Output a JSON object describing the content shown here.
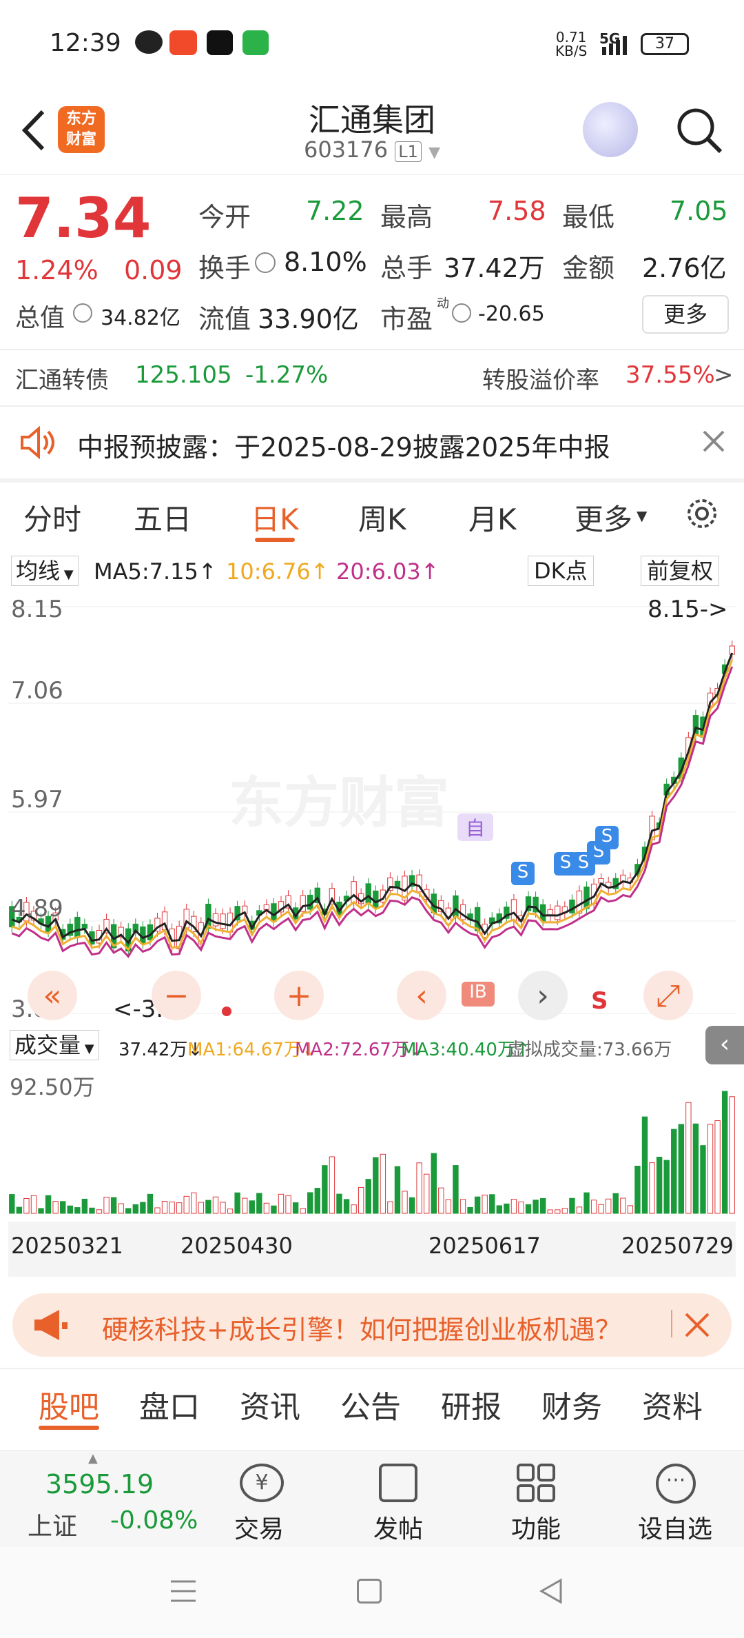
{
  "status_bar": {
    "time": "12:39",
    "net_speed": "0.71",
    "net_unit": "KB/S",
    "signal": "5G",
    "battery": "37"
  },
  "header": {
    "title": "汇通集团",
    "code": "603176",
    "level": "L1",
    "logo_text_1": "东方",
    "logo_text_2": "财富"
  },
  "quote": {
    "price": "7.34",
    "change_pct": "1.24%",
    "change": "0.09",
    "open_label": "今开",
    "open": "7.22",
    "high_label": "最高",
    "high": "7.58",
    "low_label": "最低",
    "low": "7.05",
    "turnover_label": "换手",
    "turnover": "8.10%",
    "volume_label": "总手",
    "volume": "37.42万",
    "amount_label": "金额",
    "amount": "2.76亿",
    "mktcap_label": "总值",
    "mktcap": "34.82亿",
    "float_label": "流值",
    "float": "33.90亿",
    "pe_label": "市盈",
    "pe_sup": "动",
    "pe": "-20.65",
    "more_button": "更多"
  },
  "bond": {
    "label": "汇通转债",
    "price": "125.105",
    "change": "-1.27%",
    "premium_label": "转股溢价率",
    "premium": "37.55%"
  },
  "notice": {
    "text": "中报预披露：于2025-08-29披露2025年中报"
  },
  "k_tabs": [
    "分时",
    "五日",
    "日K",
    "周K",
    "月K",
    "更多"
  ],
  "k_tab_active": "日K",
  "ma_bar": {
    "selector": "均线",
    "ma5": "MA5:7.15",
    "ma10": "10:6.76",
    "ma20": "20:6.03",
    "dk": "DK点",
    "adjust": "前复权"
  },
  "chart_data": {
    "type": "candlestick",
    "y_ticks": [
      "8.15",
      "7.06",
      "5.97",
      "4.89",
      "3.80"
    ],
    "max_label": "8.15->",
    "min_label": "<-3.80",
    "markers": {
      "self": "自",
      "sell": "S",
      "bs": "IB"
    },
    "x_ticks": [
      "20250321",
      "20250430",
      "20250617",
      "20250729"
    ],
    "watermark": "东方财富",
    "colors": {
      "up": "#e0363a",
      "down": "#1a9a3a",
      "ma5": "#222222",
      "ma10": "#f0b030",
      "ma20": "#c0308a"
    }
  },
  "volume_bar": {
    "selector": "成交量",
    "vol": "37.42万",
    "ma1": "MA1:64.67万",
    "ma2": "MA2:72.67万",
    "ma3": "MA3:40.40万",
    "virtual": "虚拟成交量:73.66万",
    "max": "92.50万"
  },
  "banner": {
    "text": "硬核科技+成长引擎！如何把握创业板机遇？"
  },
  "bottom_tabs": [
    "股吧",
    "盘口",
    "资讯",
    "公告",
    "研报",
    "财务",
    "资料"
  ],
  "bottom_tab_active": "股吧",
  "nav": {
    "index_value": "3595.19",
    "index_name": "上证",
    "index_change": "-0.08%",
    "trade": "交易",
    "post": "发帖",
    "function": "功能",
    "watchlist": "设自选"
  }
}
